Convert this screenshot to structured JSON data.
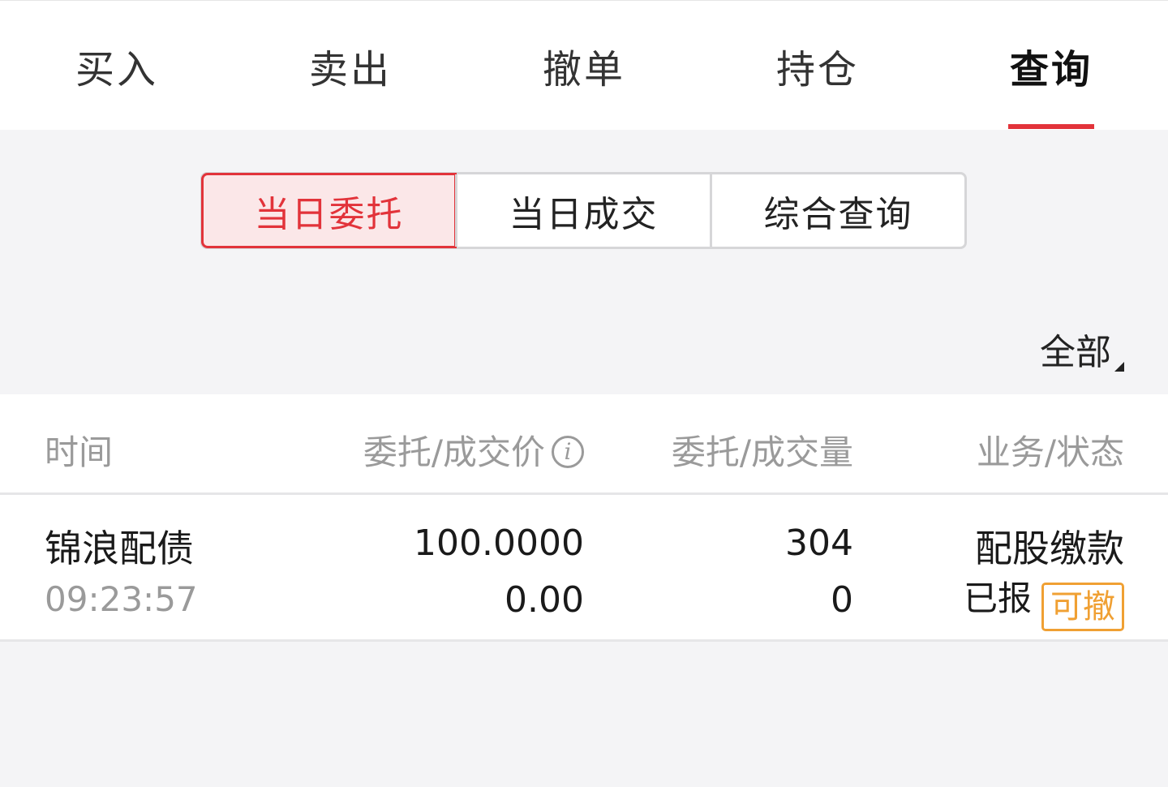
{
  "top_tabs": [
    {
      "label": "买入"
    },
    {
      "label": "卖出"
    },
    {
      "label": "撤单"
    },
    {
      "label": "持仓"
    },
    {
      "label": "查询"
    }
  ],
  "active_tab": "查询",
  "sub_tabs": [
    {
      "label": "当日委托"
    },
    {
      "label": "当日成交"
    },
    {
      "label": "综合查询"
    }
  ],
  "active_sub_tab": "当日委托",
  "filter": {
    "label": "全部"
  },
  "table": {
    "headers": {
      "time": "时间",
      "price": "委托/成交价",
      "quantity": "委托/成交量",
      "status": "业务/状态"
    },
    "rows": [
      {
        "name": "锦浪配债",
        "time": "09:23:57",
        "order_price": "100.0000",
        "deal_price": "0.00",
        "order_qty": "304",
        "deal_qty": "0",
        "business": "配股缴款",
        "status": "已报",
        "action": "可撤"
      }
    ]
  },
  "colors": {
    "accent": "#e2333a",
    "badge": "#f0a033"
  }
}
